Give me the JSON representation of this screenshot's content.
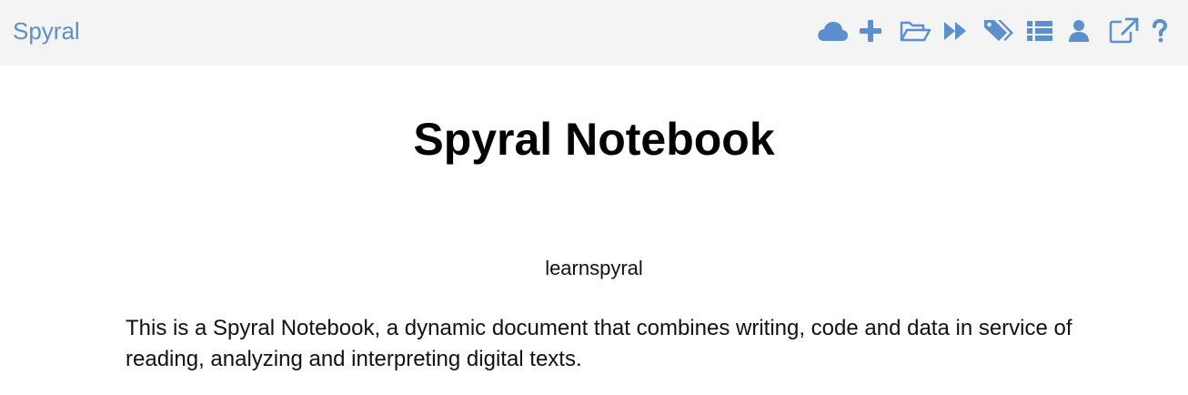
{
  "app": {
    "brand": "Spyral"
  },
  "toolbar": {
    "icons": [
      {
        "name": "cloud-icon",
        "label": "cloud"
      },
      {
        "name": "plus-icon",
        "label": "new"
      },
      {
        "name": "folder-open-icon",
        "label": "open"
      },
      {
        "name": "fast-forward-icon",
        "label": "run all"
      },
      {
        "name": "tags-icon",
        "label": "tags"
      },
      {
        "name": "list-icon",
        "label": "list"
      },
      {
        "name": "user-icon",
        "label": "user"
      },
      {
        "name": "external-link-icon",
        "label": "export"
      },
      {
        "name": "question-icon",
        "label": "help"
      }
    ],
    "accent_color": "#5b8fce"
  },
  "notebook": {
    "title": "Spyral Notebook",
    "author": "learnspyral",
    "intro": "This is a Spyral Notebook, a dynamic document that combines writing, code and data in service of reading, analyzing and interpreting digital texts."
  }
}
